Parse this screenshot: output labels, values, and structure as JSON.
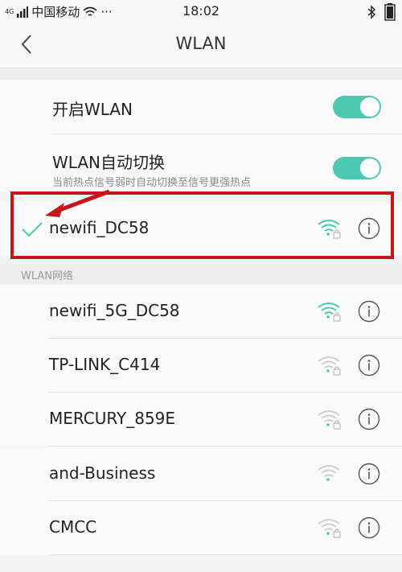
{
  "status_bar": {
    "network_tag": "4G",
    "carrier": "中国移动",
    "more": "···",
    "time": "18:02"
  },
  "header": {
    "title": "WLAN"
  },
  "settings": {
    "enable_wlan": {
      "label": "开启WLAN",
      "on": true
    },
    "auto_switch": {
      "label": "WLAN自动切换",
      "description": "当前热点信号弱时自动切换至信号更强热点",
      "on": true
    }
  },
  "connected_network": {
    "name": "newifi_DC58",
    "secured": true,
    "signal": "strong"
  },
  "section_label": "WLAN网络",
  "networks": [
    {
      "name": "newifi_5G_DC58",
      "secured": true,
      "signal": "strong"
    },
    {
      "name": "TP-LINK_C414",
      "secured": true,
      "signal": "weak"
    },
    {
      "name": "MERCURY_859E",
      "secured": true,
      "signal": "weak"
    },
    {
      "name": "and-Business",
      "secured": false,
      "signal": "weak"
    },
    {
      "name": "CMCC",
      "secured": true,
      "signal": "weak"
    }
  ],
  "colors": {
    "accent": "#4dc8b2",
    "annotation": "#c8141b"
  }
}
